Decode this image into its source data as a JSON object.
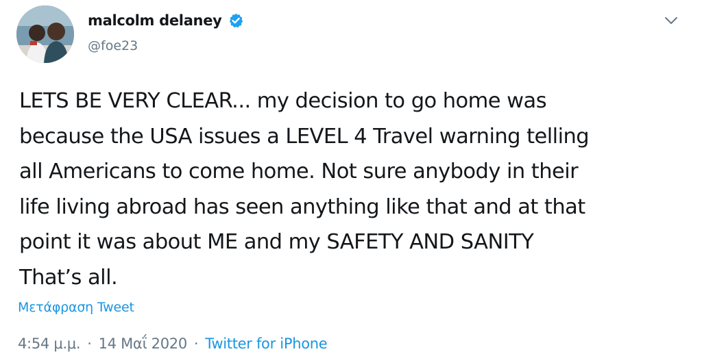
{
  "tweet": {
    "author": {
      "display_name": "malcolm delaney",
      "handle": "@foe23",
      "verified": true,
      "avatar_icon": "avatar-photo"
    },
    "text": "LETS BE VERY CLEAR... my decision to go home was\nbecause the USA issues a LEVEL 4 Travel warning telling\nall Americans to come home. Not sure anybody in their\nlife living abroad has seen anything like that and at that\npoint it was about ME and my SAFETY AND SANITY\nThat’s all.",
    "translate_label": "Μετάφραση Tweet",
    "time": "4:54 μ.μ.",
    "date": "14 Μαΐ 2020",
    "separator": "·",
    "source": "Twitter for iPhone"
  },
  "colors": {
    "link": "#1b95e0",
    "muted": "#657786",
    "text": "#14171a",
    "verified": "#1da1f2"
  }
}
